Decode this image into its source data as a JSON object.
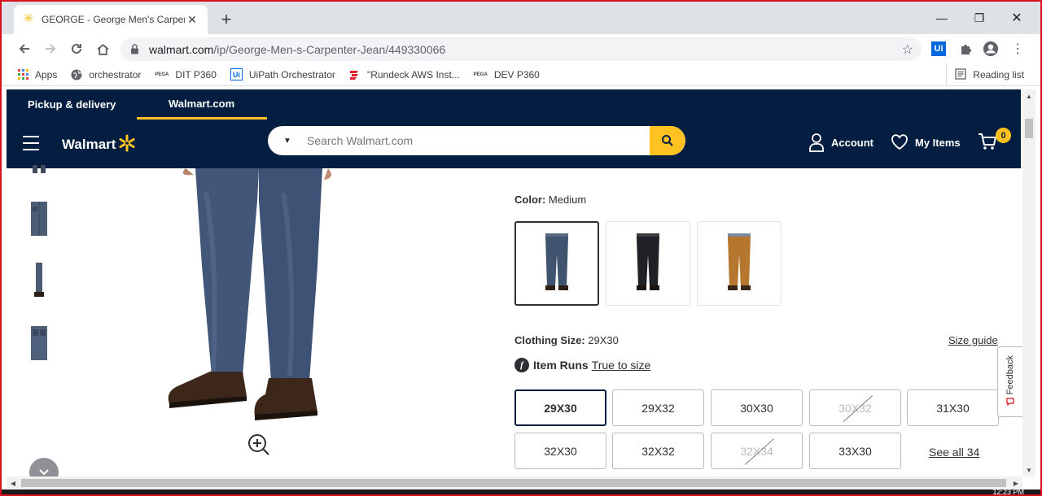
{
  "browser": {
    "tab_title": "GEORGE - George Men's Carpenter Jean",
    "url_host": "walmart.com",
    "url_path": "/ip/George-Men-s-Carpenter-Jean/449330066",
    "bookmarks": [
      {
        "label": "Apps",
        "icon": "apps-grid-icon"
      },
      {
        "label": "orchestrator",
        "icon": "globe-icon"
      },
      {
        "label": "DIT P360",
        "icon": "pega-icon"
      },
      {
        "label": "UiPath Orchestrator",
        "icon": "uipath-icon"
      },
      {
        "label": "\"Rundeck AWS Inst...",
        "icon": "rundeck-icon"
      },
      {
        "label": "DEV P360",
        "icon": "pega-icon"
      }
    ],
    "reading_list": "Reading list",
    "clock": "12:23 PM"
  },
  "walmart": {
    "top_tabs": [
      {
        "label": "Pickup & delivery",
        "active": false
      },
      {
        "label": "Walmart.com",
        "active": true
      }
    ],
    "logo": "Walmart",
    "search_placeholder": "Search Walmart.com",
    "account": "Account",
    "my_items": "My Items",
    "cart_count": "0",
    "colors": {
      "navy": "#041e42",
      "yellow": "#ffc220"
    }
  },
  "product": {
    "color_label": "Color:",
    "color_value": "Medium",
    "swatches": [
      {
        "name": "Medium",
        "tone": "#41546f",
        "selected": true
      },
      {
        "name": "Black",
        "tone": "#1f2126",
        "selected": false
      },
      {
        "name": "Brown",
        "tone": "#b5772e",
        "selected": false
      }
    ],
    "size_label": "Clothing Size:",
    "size_value": "29X30",
    "size_guide": "Size guide",
    "fit_prefix": "f",
    "fit_label": "Item Runs",
    "fit_value": "True to size",
    "sizes": [
      {
        "label": "29X30",
        "selected": true,
        "oos": false
      },
      {
        "label": "29X32",
        "selected": false,
        "oos": false
      },
      {
        "label": "30X30",
        "selected": false,
        "oos": false
      },
      {
        "label": "30X32",
        "selected": false,
        "oos": true
      },
      {
        "label": "31X30",
        "selected": false,
        "oos": false
      },
      {
        "label": "32X30",
        "selected": false,
        "oos": false
      },
      {
        "label": "32X32",
        "selected": false,
        "oos": false
      },
      {
        "label": "32X34",
        "selected": false,
        "oos": true
      },
      {
        "label": "33X30",
        "selected": false,
        "oos": false
      }
    ],
    "see_all": "See all 34"
  },
  "feedback": "Feedback"
}
